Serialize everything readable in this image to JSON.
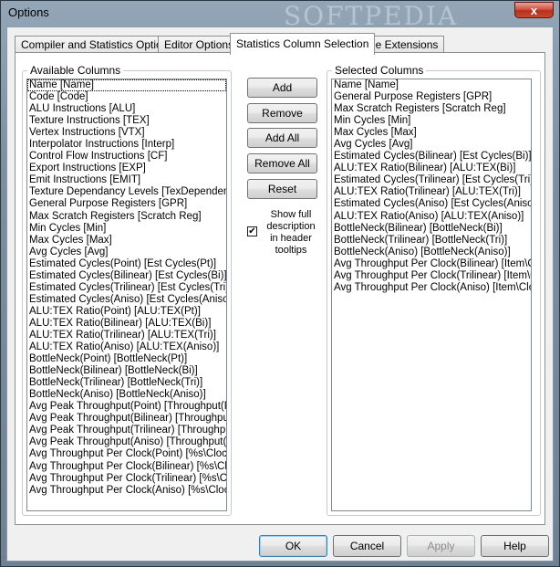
{
  "window": {
    "title": "Options",
    "close_glyph": "x"
  },
  "tabs": [
    {
      "label": "Compiler and Statistics Options"
    },
    {
      "label": "Editor Options"
    },
    {
      "label": "Statistics Column Selection"
    },
    {
      "label": "File Extensions"
    }
  ],
  "available": {
    "label": "Available Columns",
    "items": [
      "Name [Name]",
      "Code [Code]",
      "ALU Instructions [ALU]",
      "Texture Instructions [TEX]",
      "Vertex Instructions [VTX]",
      "Interpolator Instructions [Interp]",
      "Control Flow Instructions [CF]",
      "Export Instructions [EXP]",
      "Emit Instructions [EMIT]",
      "Texture Dependancy Levels [TexDependenc",
      "General Purpose Registers [GPR]",
      "Max Scratch Registers [Scratch Reg]",
      "Min Cycles [Min]",
      "Max Cycles [Max]",
      "Avg Cycles [Avg]",
      "Estimated Cycles(Point) [Est Cycles(Pt)]",
      "Estimated Cycles(Bilinear) [Est Cycles(Bi)]",
      "Estimated Cycles(Trilinear) [Est Cycles(Tri)]",
      "Estimated Cycles(Aniso) [Est Cycles(Aniso)]",
      "ALU:TEX Ratio(Point) [ALU:TEX(Pt)]",
      "ALU:TEX Ratio(Bilinear) [ALU:TEX(Bi)]",
      "ALU:TEX Ratio(Trilinear) [ALU:TEX(Tri)]",
      "ALU:TEX Ratio(Aniso) [ALU:TEX(Aniso)]",
      "BottleNeck(Point) [BottleNeck(Pt)]",
      "BottleNeck(Bilinear) [BottleNeck(Bi)]",
      "BottleNeck(Trilinear) [BottleNeck(Tri)]",
      "BottleNeck(Aniso) [BottleNeck(Aniso)]",
      "Avg Peak Throughput(Point) [Throughput(Pt",
      "Avg Peak Throughput(Bilinear) [Throughput(",
      "Avg Peak Throughput(Trilinear) [Throughput",
      "Avg Peak Throughput(Aniso) [Throughput(Ar",
      "Avg Throughput Per Clock(Point) [%s\\Clock(",
      "Avg Throughput Per Clock(Bilinear) [%s\\Clo",
      "Avg Throughput Per Clock(Trilinear) [%s\\Clo",
      "Avg Throughput Per Clock(Aniso) [%s\\Clock"
    ]
  },
  "selected": {
    "label": "Selected Columns",
    "items": [
      "Name [Name]",
      "General Purpose Registers [GPR]",
      "Max Scratch Registers [Scratch Reg]",
      "Min Cycles [Min]",
      "Max Cycles [Max]",
      "Avg Cycles [Avg]",
      "Estimated Cycles(Bilinear) [Est Cycles(Bi)]",
      "ALU:TEX Ratio(Bilinear) [ALU:TEX(Bi)]",
      "Estimated Cycles(Trilinear) [Est Cycles(Tri)]",
      "ALU:TEX Ratio(Trilinear) [ALU:TEX(Tri)]",
      "Estimated Cycles(Aniso) [Est Cycles(Aniso)]",
      "ALU:TEX Ratio(Aniso) [ALU:TEX(Aniso)]",
      "BottleNeck(Bilinear) [BottleNeck(Bi)]",
      "BottleNeck(Trilinear) [BottleNeck(Tri)]",
      "BottleNeck(Aniso) [BottleNeck(Aniso)]",
      "Avg Throughput Per Clock(Bilinear) [Item\\Cl",
      "Avg Throughput Per Clock(Trilinear) [Item\\Clo",
      "Avg Throughput Per Clock(Aniso) [Item\\Cloc"
    ]
  },
  "buttons": {
    "add": "Add",
    "remove": "Remove",
    "add_all": "Add All",
    "remove_all": "Remove All",
    "reset": "Reset"
  },
  "option": {
    "label": "Show full description in header tooltips",
    "checked": true,
    "check_glyph": "✔"
  },
  "footer": {
    "ok": "OK",
    "cancel": "Cancel",
    "apply": "Apply",
    "help": "Help"
  },
  "watermark": "SOFTPEDIA"
}
